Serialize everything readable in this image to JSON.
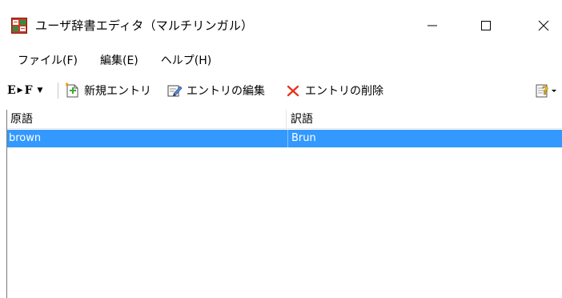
{
  "window": {
    "title": "ユーザ辞書エディタ（マルチリンガル）",
    "controls": {
      "minimize": "—",
      "maximize": "☐",
      "close": "✕"
    }
  },
  "menu": {
    "items": [
      {
        "label": "ファイル(F)"
      },
      {
        "label": "編集(E)"
      },
      {
        "label": "ヘルプ(H)"
      }
    ]
  },
  "toolbar": {
    "language_pair": {
      "source": "E",
      "target": "F"
    },
    "new_entry": "新規エントリ",
    "edit_entry": "エントリの編集",
    "delete_entry": "エントリの削除"
  },
  "list": {
    "columns": [
      "原語",
      "訳語"
    ],
    "rows": [
      {
        "source": "brown",
        "target": "Brun",
        "selected": true
      }
    ]
  },
  "colors": {
    "selection": "#3399ff",
    "selection_text": "#ffffff",
    "delete_icon": "#e8341c",
    "new_icon": "#3cab32",
    "help_icon": "#f0c020"
  },
  "icons": {
    "app": "dictionary-app-icon",
    "new": "new-entry-icon",
    "edit": "edit-entry-icon",
    "delete": "delete-x-icon",
    "help": "help-icon"
  }
}
